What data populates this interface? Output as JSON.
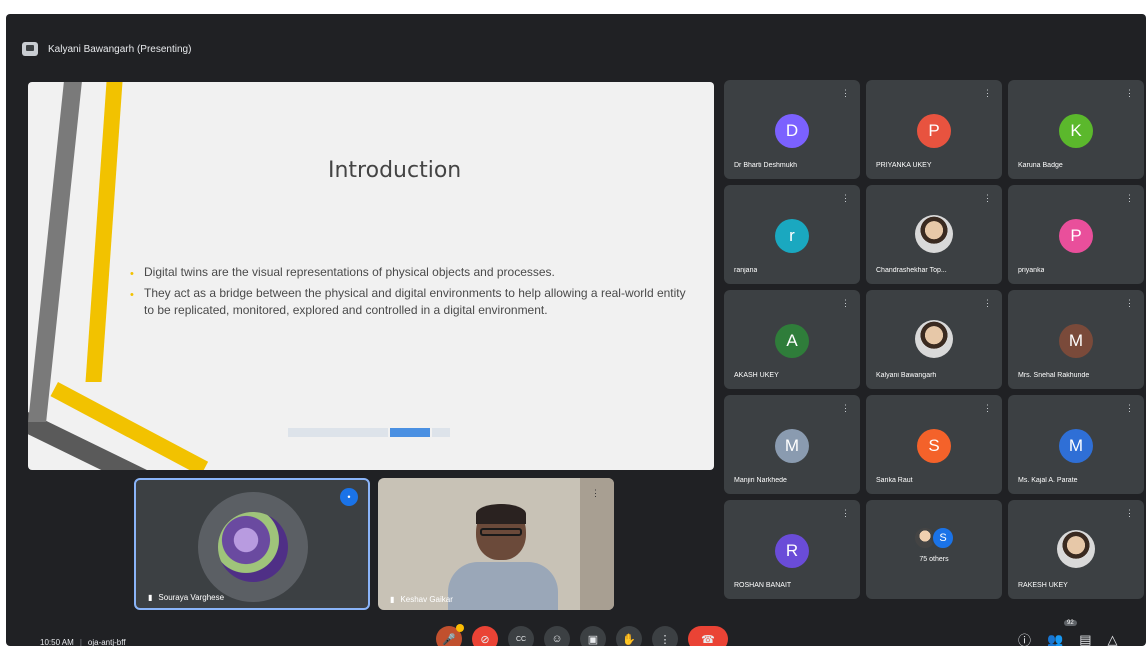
{
  "header": {
    "title": "Kalyani Bawangarh (Presenting)",
    "icon": "present-icon"
  },
  "slide": {
    "title": "Introduction",
    "bullets": [
      "Digital twins are the visual representations of physical objects and processes.",
      "They act as a bridge between the physical and digital environments to help allowing a real-world entity to be replicated, monitored, explored and controlled in a digital environment."
    ],
    "accent": "#f2c200"
  },
  "mini_tiles": [
    {
      "name": "Souraya Varghese"
    },
    {
      "name": "Keshav Gaikar"
    }
  ],
  "participants": [
    {
      "name": "Dr Bharti Deshmukh",
      "initial": "D",
      "color": "#7b61ff"
    },
    {
      "name": "PRIYANKA UKEY",
      "initial": "P",
      "color": "#e8533f"
    },
    {
      "name": "Karuna Badge",
      "initial": "K",
      "color": "#5bb82c"
    },
    {
      "name": "ranjana",
      "initial": "r",
      "color": "#1aa8c0"
    },
    {
      "name": "Chandrashekhar Top...",
      "initial": "",
      "color": ""
    },
    {
      "name": "priyanka",
      "initial": "P",
      "color": "#e94f9b"
    },
    {
      "name": "AKASH UKEY",
      "initial": "A",
      "color": "#2f7d3a"
    },
    {
      "name": "Kalyani Bawangarh",
      "initial": "",
      "color": ""
    },
    {
      "name": "Mrs. Snehal Rakhunde",
      "initial": "M",
      "color": "#7a4a3a"
    },
    {
      "name": "Manjiri Narkhede",
      "initial": "M",
      "color": "#8a9bb0"
    },
    {
      "name": "Sarika Raut",
      "initial": "S",
      "color": "#f4622a"
    },
    {
      "name": "Ms. Kajal A. Parate",
      "initial": "M",
      "color": "#2f6fd6"
    },
    {
      "name": "ROSHAN BANAIT",
      "initial": "R",
      "color": "#6a4cd8"
    },
    {
      "name": "75 others",
      "initial": "S",
      "color": "#1a73e8"
    },
    {
      "name": "RAKESH UKEY",
      "initial": "",
      "color": ""
    }
  ],
  "footer": {
    "time": "10:50 AM",
    "meeting_code": "oja-antj-bff",
    "cc_label": "CC",
    "people_count": "92"
  }
}
